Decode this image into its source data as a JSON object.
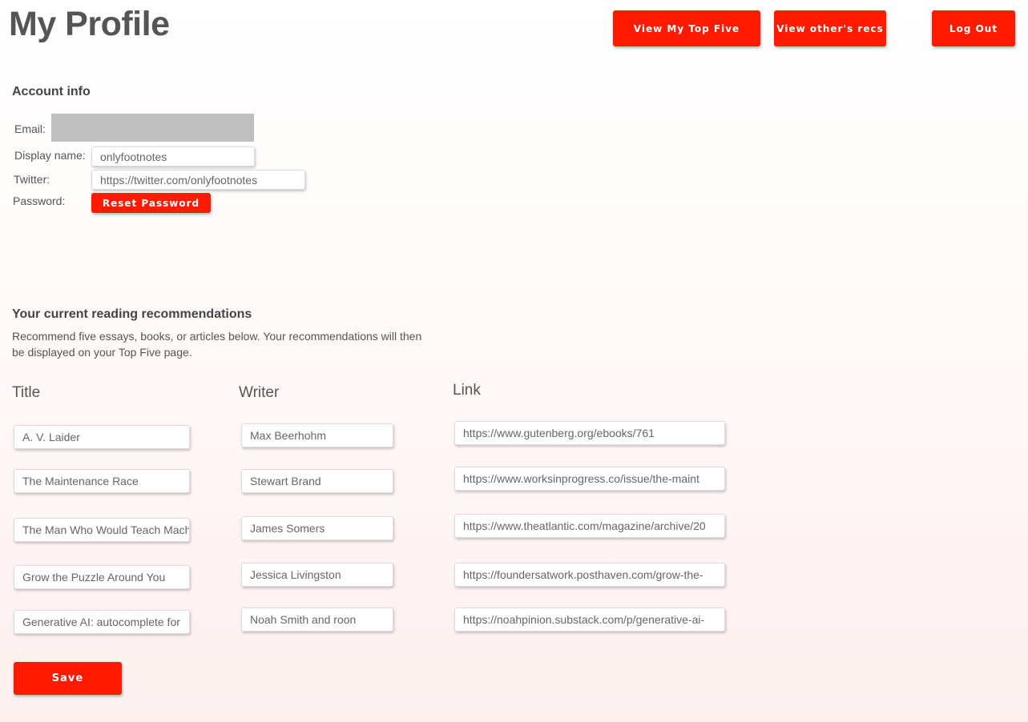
{
  "header": {
    "title": "My Profile",
    "nav": {
      "top_five": "View My Top Five",
      "others": "View other's recs",
      "logout": "Log Out"
    }
  },
  "account": {
    "heading": "Account info",
    "email_label": "Email:",
    "display_name_label": "Display name:",
    "display_name_value": "onlyfootnotes",
    "twitter_label": "Twitter:",
    "twitter_value": "https://twitter.com/onlyfootnotes",
    "password_label": "Password:",
    "reset_password": "Reset Password"
  },
  "recs": {
    "heading": "Your current reading recommendations",
    "description": "Recommend five essays, books, or articles below. Your recommendations will then be displayed on your Top Five page.",
    "columns": {
      "title": "Title",
      "writer": "Writer",
      "link": "Link"
    },
    "rows": [
      {
        "title": "A. V. Laider",
        "writer": "Max Beerhohm",
        "link": "https://www.gutenberg.org/ebooks/761"
      },
      {
        "title": "The Maintenance Race",
        "writer": "Stewart Brand",
        "link": "https://www.worksinprogress.co/issue/the-maint"
      },
      {
        "title": "The Man Who Would Teach Mach",
        "writer": "James Somers",
        "link": "https://www.theatlantic.com/magazine/archive/20"
      },
      {
        "title": "Grow the Puzzle Around You",
        "writer": "Jessica Livingston",
        "link": "https://foundersatwork.posthaven.com/grow-the-"
      },
      {
        "title": "Generative AI: autocomplete for",
        "writer": "Noah Smith and roon",
        "link": "https://noahpinion.substack.com/p/generative-ai-"
      }
    ],
    "save": "Save"
  },
  "colors": {
    "accent": "#ff1a00",
    "text": "#555555"
  }
}
